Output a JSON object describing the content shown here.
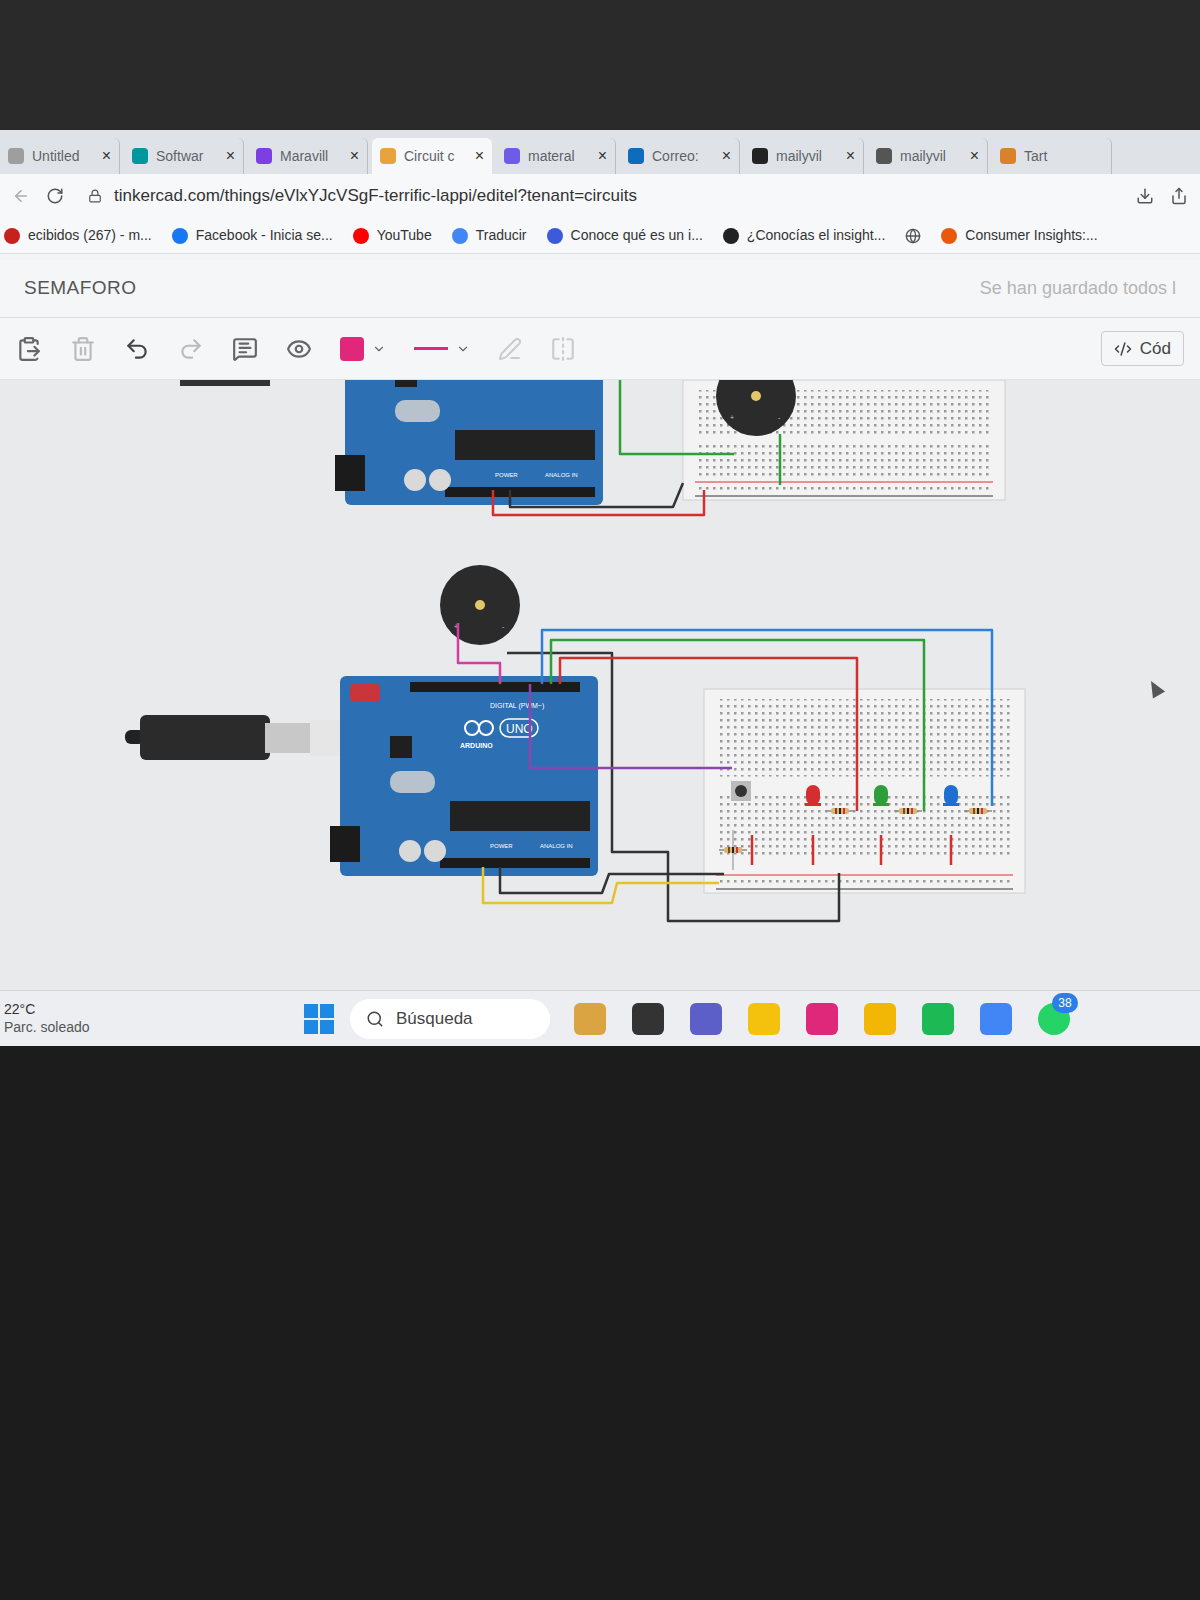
{
  "browser": {
    "tabs": [
      {
        "label": "Untitled",
        "close": "×",
        "selected": false,
        "color": "#9e9e9e"
      },
      {
        "label": "Softwar",
        "close": "×",
        "selected": false,
        "color": "#00979d"
      },
      {
        "label": "Maravill",
        "close": "×",
        "selected": false,
        "color": "#7b3fe4"
      },
      {
        "label": "Circuit c",
        "close": "×",
        "selected": true,
        "color": "#e8a33d"
      },
      {
        "label": "materal",
        "close": "×",
        "selected": false,
        "color": "#6c5ce7"
      },
      {
        "label": "Correo:",
        "close": "×",
        "selected": false,
        "color": "#0f6cbd"
      },
      {
        "label": "mailyvil",
        "close": "×",
        "selected": false,
        "color": "#222222"
      },
      {
        "label": "mailyvil",
        "close": "×",
        "selected": false,
        "color": "#555555"
      },
      {
        "label": "Tart",
        "close": "",
        "selected": false,
        "color": "#d9822b"
      }
    ],
    "address": "tinkercad.com/things/eVlxYJcVSgF-terrific-lappi/editel?tenant=circuits",
    "bookmarks": [
      {
        "label": "ecibidos (267) - m...",
        "color": "#c5221f"
      },
      {
        "label": "Facebook - Inicia se...",
        "color": "#1877f2"
      },
      {
        "label": "YouTube",
        "color": "#ff0000"
      },
      {
        "label": "Traducir",
        "color": "#4285f4"
      },
      {
        "label": "Conoce qué es un i...",
        "color": "#3b5bdb"
      },
      {
        "label": "¿Conocías el insight...",
        "color": "#222222"
      },
      {
        "label": "Consumer Insights:...",
        "color": "#e8590c"
      }
    ]
  },
  "app": {
    "title": "SEMAFORO",
    "save_status": "Se han guardado todos l",
    "code_button": "Cód",
    "fill_color": "#e0287a",
    "line_color": "#e0287a"
  },
  "circuit": {
    "arduinos": [
      {
        "labels": [
          "POWER",
          "ANALOG IN"
        ]
      },
      {
        "labels": [
          "DIGITAL (PWM~)",
          "UNO",
          "ARDUINO",
          "POWER",
          "ANALOG IN"
        ]
      }
    ],
    "leds": [
      {
        "color": "#d32f2f"
      },
      {
        "color": "#2e9e3a"
      },
      {
        "color": "#1e6fd1"
      }
    ]
  },
  "taskbar": {
    "weather_temp": "22°C",
    "weather_text": "Parc. soleado",
    "search": "Búsqueda",
    "badge": "38"
  }
}
